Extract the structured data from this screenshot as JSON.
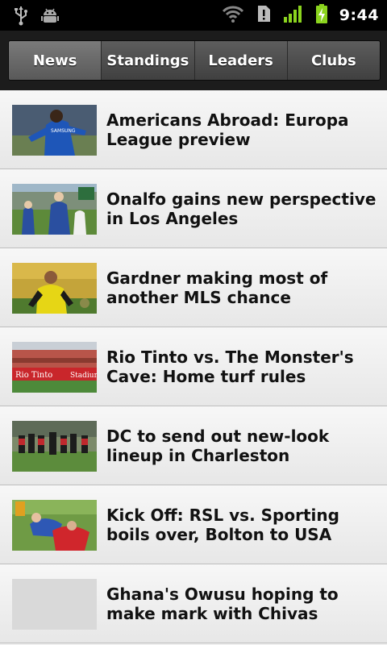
{
  "status_bar": {
    "time": "9:44",
    "icons": [
      "usb-icon",
      "android-debug-icon",
      "wifi-icon",
      "sd-card-warning-icon",
      "signal-icon",
      "battery-charging-icon"
    ]
  },
  "tabs": [
    {
      "label": "News",
      "active": true
    },
    {
      "label": "Standings",
      "active": false
    },
    {
      "label": "Leaders",
      "active": false
    },
    {
      "label": "Clubs",
      "active": false
    }
  ],
  "news": [
    {
      "title": "Americans Abroad: Europa League preview"
    },
    {
      "title": "Onalfo gains new perspective in Los Angeles"
    },
    {
      "title": "Gardner making most of another MLS chance"
    },
    {
      "title": "Rio Tinto vs. The Monster's Cave: Home turf rules"
    },
    {
      "title": "DC to send out new-look lineup in Charleston"
    },
    {
      "title": "Kick Off: RSL vs. Sporting boils over, Bolton to USA"
    },
    {
      "title": "Ghana's Owusu hoping to make mark with Chivas"
    }
  ],
  "thumb_texts": {
    "photo_1_sponsor": "SAMSUNG",
    "photo_4_banner_left": "Rio Tinto",
    "photo_4_banner_right": "Stadium"
  },
  "colors": {
    "status_bar_bg": "#000000",
    "tab_bg": "#1c1c1c",
    "list_bg": "#efefef",
    "title_text": "#111111",
    "status_accent": "#8bd41e"
  }
}
